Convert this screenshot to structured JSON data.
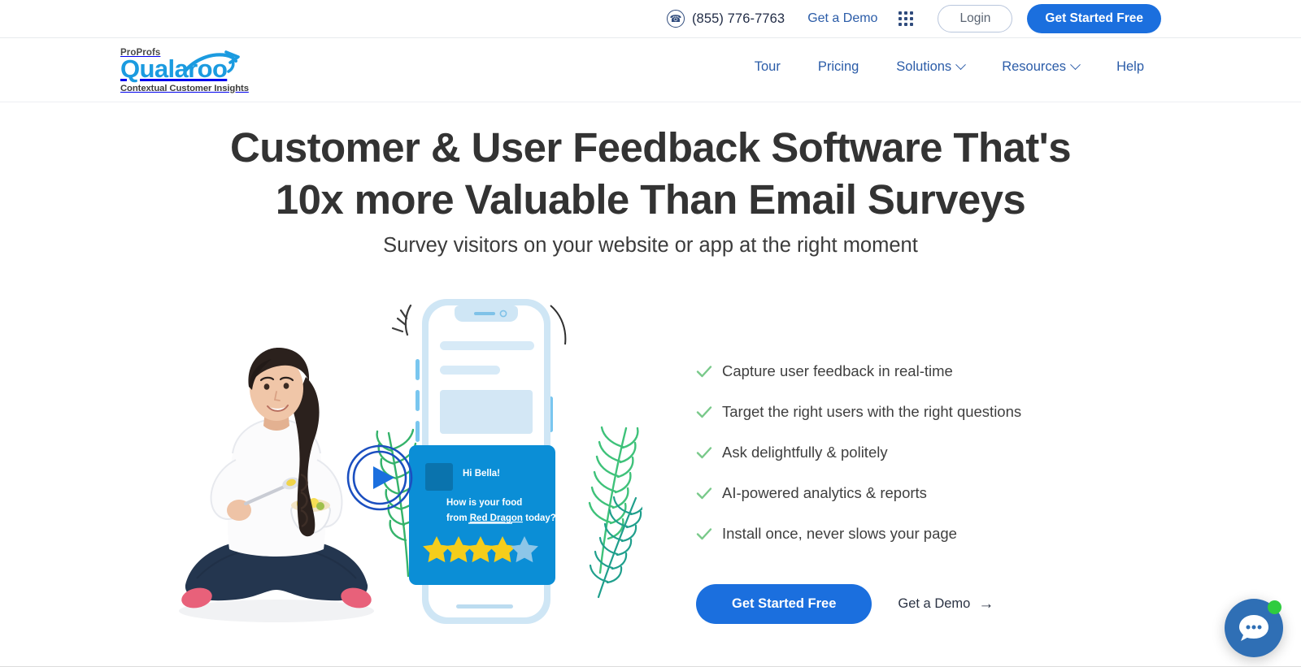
{
  "utility_bar": {
    "phone_icon": "phone-icon",
    "phone_number": "(855) 776-7763",
    "demo_link": "Get a Demo",
    "grid_icon": "apps-grid-icon",
    "login_label": "Login",
    "get_started_label": "Get Started Free"
  },
  "logo": {
    "eyebrow": "ProProfs",
    "name": "Qualaroo",
    "tagline": "Contextual Customer Insights",
    "mark": "kangaroo-swoosh-icon"
  },
  "nav": {
    "items": [
      {
        "label": "Tour",
        "has_caret": false
      },
      {
        "label": "Pricing",
        "has_caret": false
      },
      {
        "label": "Solutions",
        "has_caret": true
      },
      {
        "label": "Resources",
        "has_caret": true
      },
      {
        "label": "Help",
        "has_caret": false
      }
    ]
  },
  "hero": {
    "title_line1": "Customer & User Feedback Software That's",
    "title_line2": "10x more Valuable Than Email Surveys",
    "subtitle": "Survey visitors on your website or app at the right moment"
  },
  "features": [
    "Capture user feedback in real-time",
    "Target the right users with the right questions",
    "Ask delightfully & politely",
    "AI-powered analytics & reports",
    "Install once, never slows your page"
  ],
  "cta": {
    "primary_label": "Get Started Free",
    "secondary_label": "Get a Demo",
    "secondary_arrow": "arrow-right-icon"
  },
  "illustration": {
    "play_icon": "play-button-icon",
    "woman_alt": "woman-eating-bowl-illustration",
    "survey_card": {
      "greeting": "Hi Bella!",
      "question_line1": "How is your food",
      "question_line2_pre": "from ",
      "question_brand": "Red Dragon",
      "question_line2_post": " today?",
      "stars_total": 5,
      "stars_filled": 4
    }
  },
  "chat": {
    "icon": "chat-bubble-icon",
    "status": "online-status-dot"
  },
  "colors": {
    "primary_blue": "#1b6fde",
    "logo_blue": "#1b9be0",
    "nav_blue": "#2b5ca8",
    "survey_blue": "#0b8ed6",
    "star_yellow": "#f5cd1b",
    "check_green": "#79c98a",
    "chat_blue": "#2f6fb5",
    "status_green": "#2fcc3f",
    "heading_gray": "#333333"
  }
}
